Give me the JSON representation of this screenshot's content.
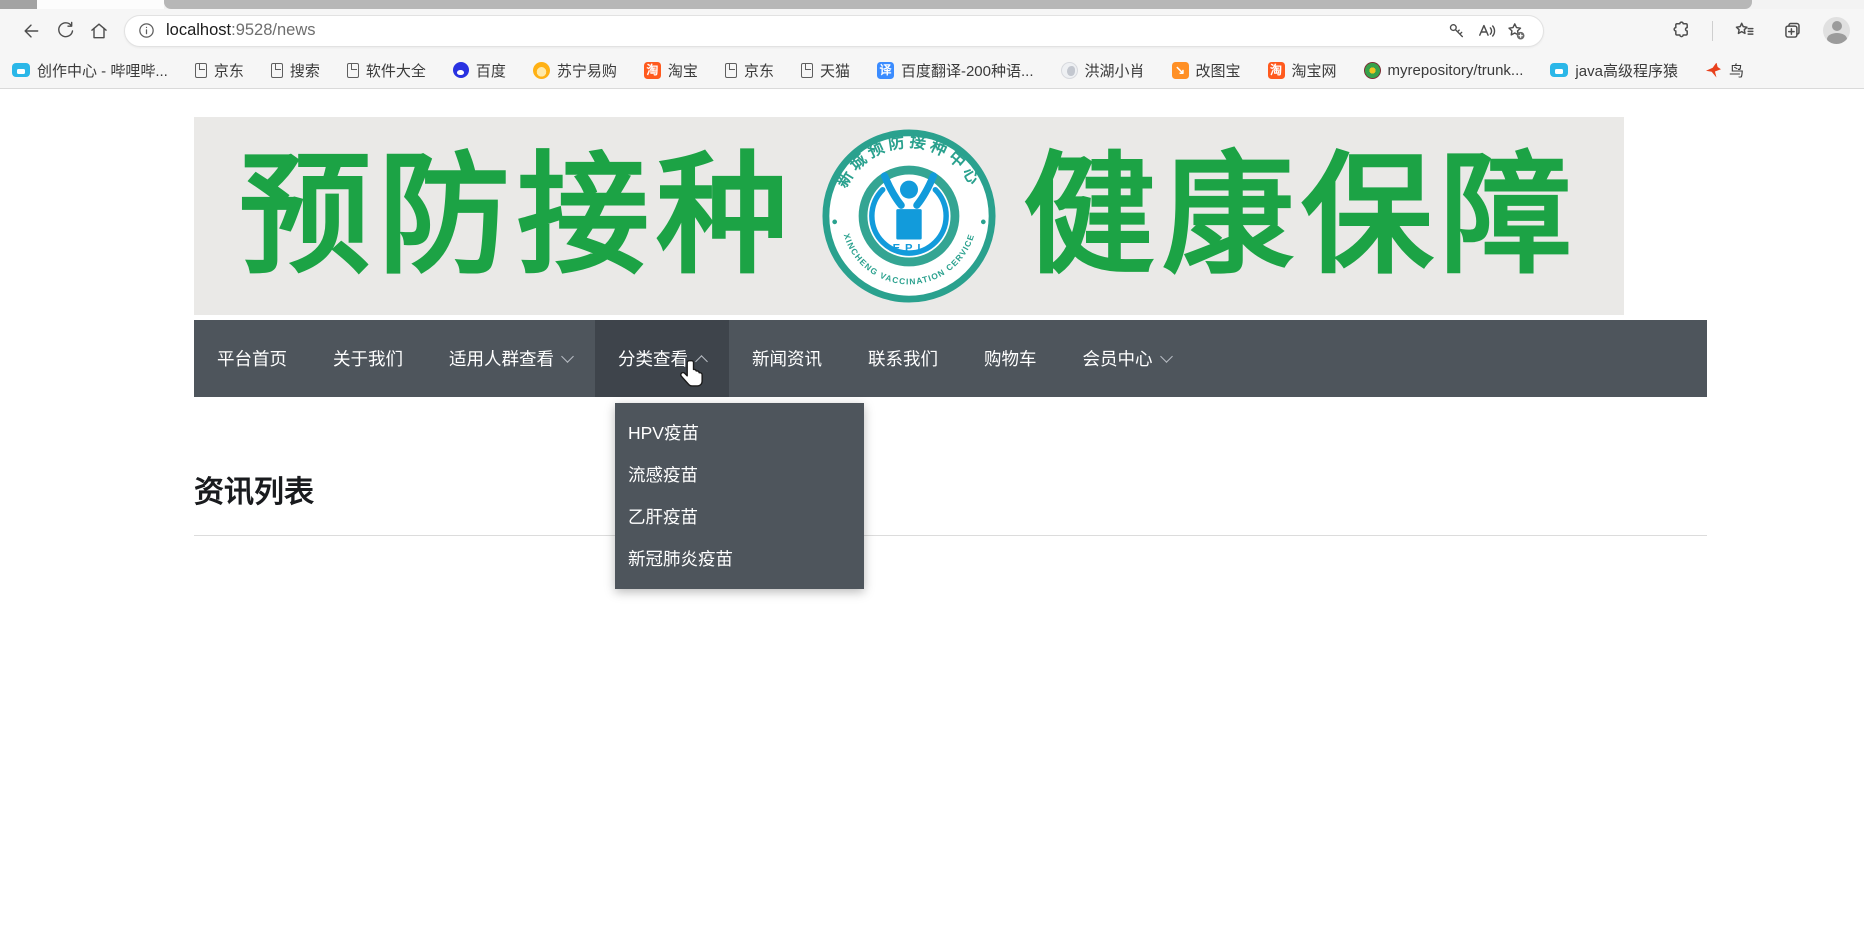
{
  "browser": {
    "url_host": "localhost",
    "url_rest": ":9528/news",
    "toolbar_icons": [
      "back-icon",
      "refresh-icon",
      "home-icon",
      "info-icon",
      "key-icon",
      "read-aloud-icon",
      "add-favorite-icon",
      "extensions-icon",
      "favorites-icon",
      "collections-icon",
      "profile-avatar"
    ],
    "bookmarks": [
      {
        "label": "创作中心 - 哔哩哔...",
        "icon": {
          "name": "bilibili-icon",
          "type": "tv",
          "bg": "#2bb7e8"
        }
      },
      {
        "label": "京东",
        "icon": {
          "name": "page-icon",
          "type": "file"
        }
      },
      {
        "label": "搜索",
        "icon": {
          "name": "page-icon",
          "type": "file"
        }
      },
      {
        "label": "软件大全",
        "icon": {
          "name": "page-icon",
          "type": "file"
        }
      },
      {
        "label": "百度",
        "icon": {
          "name": "baidu-paw-icon",
          "type": "paw",
          "bg": "#2932e1"
        }
      },
      {
        "label": "苏宁易购",
        "icon": {
          "name": "suning-lion-icon",
          "type": "lion"
        }
      },
      {
        "label": "淘宝",
        "icon": {
          "name": "taobao-icon",
          "type": "badge",
          "bg": "#ff5a1e",
          "fg": "#ffffff",
          "glyph": "淘"
        }
      },
      {
        "label": "京东",
        "icon": {
          "name": "page-icon",
          "type": "file"
        }
      },
      {
        "label": "天猫",
        "icon": {
          "name": "page-icon",
          "type": "file"
        }
      },
      {
        "label": "百度翻译-200种语...",
        "icon": {
          "name": "baidu-translate-icon",
          "type": "badge",
          "bg": "#3b8cff",
          "fg": "#ffffff",
          "glyph": "译"
        }
      },
      {
        "label": "洪湖小肖",
        "icon": {
          "name": "swan-icon",
          "type": "swan"
        }
      },
      {
        "label": "改图宝",
        "icon": {
          "name": "gaitubao-icon",
          "type": "badge",
          "bg": "#ff9026",
          "fg": "#ffffff",
          "glyph": "↘"
        }
      },
      {
        "label": "淘宝网",
        "icon": {
          "name": "taobao-icon",
          "type": "badge",
          "bg": "#ff5a1e",
          "fg": "#ffffff",
          "glyph": "淘"
        }
      },
      {
        "label": "myrepository/trunk...",
        "icon": {
          "name": "repo-icon",
          "type": "rings"
        }
      },
      {
        "label": "java高级程序猿",
        "icon": {
          "name": "bilibili-icon",
          "type": "tv",
          "bg": "#2bb7e8"
        }
      },
      {
        "label": "鸟",
        "icon": {
          "name": "bird-icon",
          "type": "bird"
        }
      }
    ]
  },
  "page": {
    "banner": {
      "left_text": "预防接种",
      "right_text": "健康保障",
      "logo": {
        "ring_top": "新城预防接种中心",
        "ring_bottom": "XINCHENG VACCINATION CERVICE",
        "center_label": "EPI"
      }
    },
    "nav_items": [
      {
        "label": "平台首页"
      },
      {
        "label": "关于我们"
      },
      {
        "label": "适用人群查看",
        "chevron": "down"
      },
      {
        "label": "分类查看",
        "chevron": "up",
        "active": true
      },
      {
        "label": "新闻资讯"
      },
      {
        "label": "联系我们"
      },
      {
        "label": "购物车"
      },
      {
        "label": "会员中心",
        "chevron": "down"
      }
    ],
    "dropdown_items": [
      {
        "label": "HPV疫苗"
      },
      {
        "label": "流感疫苗"
      },
      {
        "label": "乙肝疫苗"
      },
      {
        "label": "新冠肺炎疫苗"
      }
    ],
    "heading": "资讯列表"
  },
  "colors": {
    "nav_bg": "#4e555c",
    "nav_active_bg": "#3e444b",
    "dropdown_bg": "#4e555c",
    "banner_bg": "#eae9e7",
    "banner_green": "#1ca345",
    "logo_teal": "#2aa18e",
    "logo_blue": "#129bdb",
    "chrome_bg": "#f6f6f6"
  }
}
